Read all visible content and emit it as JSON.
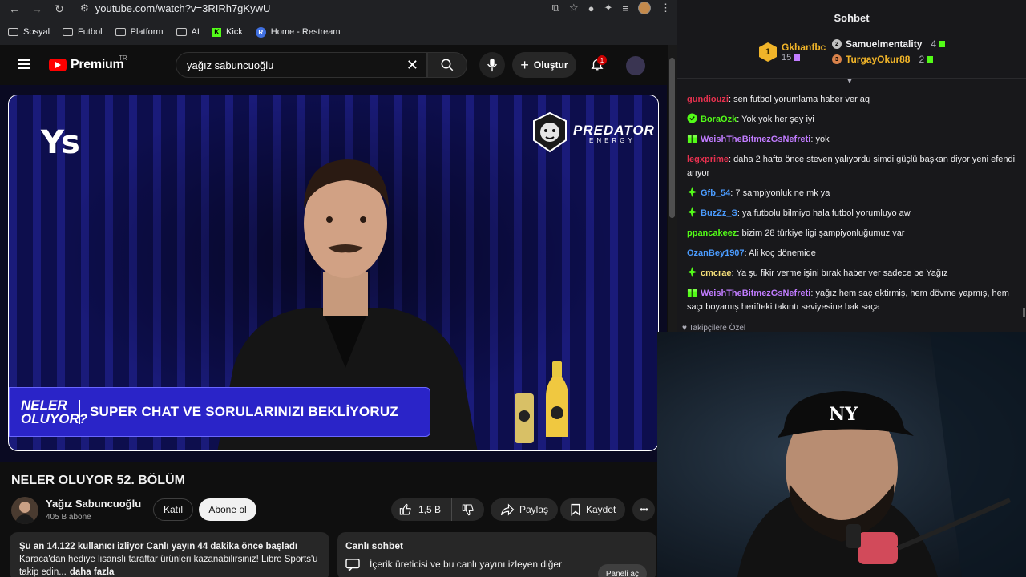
{
  "browser": {
    "url": "youtube.com/watch?v=3RIRh7gKywU",
    "bookmarks": [
      {
        "label": "Sosyal",
        "icon": "folder-icon"
      },
      {
        "label": "Futbol",
        "icon": "folder-icon"
      },
      {
        "label": "Platform",
        "icon": "folder-icon"
      },
      {
        "label": "AI",
        "icon": "folder-icon"
      },
      {
        "label": "Kick",
        "icon": "kick-icon"
      },
      {
        "label": "Home - Restream",
        "icon": "restream-icon"
      }
    ]
  },
  "youtube": {
    "logo_text": "Premium",
    "country_code": "TR",
    "search_value": "yağız sabuncuoğlu",
    "create_label": "Oluştur",
    "notification_count": "1"
  },
  "video_overlay": {
    "channel_logo": "Ys",
    "sponsor_name": "PREDATOR",
    "sponsor_sub": "ENERGY",
    "lower_third_show_line1": "NELER",
    "lower_third_show_line2": "OLUYOR?",
    "lower_third_text": "SUPER CHAT VE SORULARINIZI BEKLİYORUZ"
  },
  "video_info": {
    "title": "NELER OLUYOR 52. BÖLÜM",
    "channel_name": "Yağız Sabuncuoğlu",
    "subscribers": "405 B abone",
    "join_label": "Katıl",
    "subscribe_label": "Abone ol",
    "likes": "1,5 B",
    "share_label": "Paylaş",
    "save_label": "Kaydet"
  },
  "description": {
    "stats": "Şu an 14.122 kullanıcı izliyor  Canlı yayın 44 dakika önce başladı",
    "text": "Karaca'dan hediye lisanslı taraftar ürünleri kazanabilirsiniz! Libre Sports'u takip edin...",
    "more_label": "daha fazla"
  },
  "live_chat_card": {
    "title": "Canlı sohbet",
    "description": "İçerik üreticisi ve bu canlı yayını izleyen diğer",
    "button_label": "Paneli aç"
  },
  "chat": {
    "header": "Sohbet",
    "leaderboard": {
      "first": {
        "rank": "1",
        "name": "Gkhanfbc",
        "count": "15"
      },
      "second": {
        "rank": "2",
        "name": "Samuelmentality",
        "count": "4"
      },
      "third": {
        "rank": "3",
        "name": "TurgayOkur88",
        "count": "2"
      }
    },
    "messages": [
      {
        "user": "gundiouzi",
        "color": "#e8314f",
        "badge": "",
        "text": "sen futbol yorumlama haber ver aq"
      },
      {
        "user": "BoraOzk",
        "color": "#53fc18",
        "badge": "verified-badge",
        "text": "Yok yok her şey iyi"
      },
      {
        "user": "WeishTheBitmezGsNefreti",
        "color": "#c17cff",
        "badge": "gift-badge",
        "text": "yok"
      },
      {
        "user": "legxprime",
        "color": "#e8314f",
        "badge": "",
        "text": "daha 2 hafta önce steven yalıyordu simdi güçlü başkan diyor yeni efendi arıyor"
      },
      {
        "user": "Gfb_54",
        "color": "#4b9cff",
        "badge": "sparkle-badge",
        "text": "7 sampiyonluk ne mk ya"
      },
      {
        "user": "BuzZz_S",
        "color": "#4b9cff",
        "badge": "sparkle-badge",
        "text": "ya futbolu bilmiyo hala futbol yorumluyo aw"
      },
      {
        "user": "ppancakeez",
        "color": "#53fc18",
        "badge": "",
        "text": "bizim 28 türkiye ligi şampiyonluğumuz var"
      },
      {
        "user": "OzanBey1907",
        "color": "#4b9cff",
        "badge": "",
        "text": "Ali koç dönemide"
      },
      {
        "user": "cmcrae",
        "color": "#f6e07a",
        "badge": "sparkle-badge",
        "text": "Ya şu fikir verme işini bırak haber ver sadece be Yağız"
      },
      {
        "user": "WeishTheBitmezGsNefreti",
        "color": "#c17cff",
        "badge": "gift-badge",
        "text": "yağız hem saç ektirmiş, hem dövme yapmış, hem saçı boyamış herifteki takıntı seviyesine bak saça"
      }
    ],
    "followers_note": "Takipçilere Özel"
  },
  "colors": {
    "accent_kick": "#53fc18",
    "youtube_red": "#ff0000",
    "gold": "#f0b429"
  }
}
